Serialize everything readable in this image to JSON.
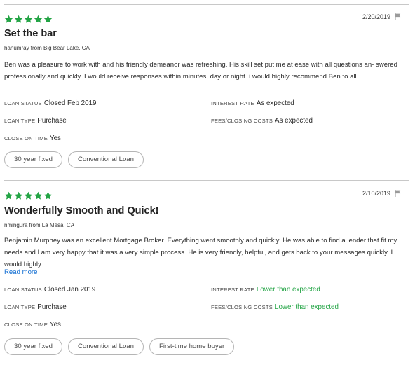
{
  "colors": {
    "star": "#23a445",
    "link": "#0b6ad1",
    "positive": "#23a445"
  },
  "icons": {
    "rating_star": "star-icon",
    "report": "flag-icon"
  },
  "reviews": [
    {
      "rating": 5,
      "date": "2/20/2019",
      "title": "Set the bar",
      "author": "hanumray from Big Bear Lake, CA",
      "body": "Ben was a pleasure to work with and his friendly demeanor was refreshing. His skill set put me at ease with all questions an- swered professionally and quickly. I would receive responses within minutes, day or night. i would highly recommend Ben to all.",
      "read_more": "",
      "loan_status_label": "LOAN STATUS",
      "loan_status": "Closed Feb 2019",
      "interest_rate_label": "INTEREST RATE",
      "interest_rate": "As expected",
      "loan_type_label": "LOAN TYPE",
      "loan_type": "Purchase",
      "fees_label": "FEES/CLOSING COSTS",
      "fees": "As expected",
      "close_on_time_label": "CLOSE ON TIME",
      "close_on_time": "Yes",
      "tags": [
        "30 year fixed",
        "Conventional Loan"
      ]
    },
    {
      "rating": 5,
      "date": "2/10/2019",
      "title": "Wonderfully Smooth and Quick!",
      "author": "nmingura from La Mesa, CA",
      "body": "Benjamin Murphey was an excellent Mortgage Broker. Everything went smoothly and quickly. He was able to find a lender that fit my needs and I am very happy that it was a very simple process. He is very friendly, helpful, and gets back to your messages quickly. I would highly ...",
      "read_more": "Read more",
      "loan_status_label": "LOAN STATUS",
      "loan_status": "Closed Jan 2019",
      "interest_rate_label": "INTEREST RATE",
      "interest_rate": "Lower than expected",
      "loan_type_label": "LOAN TYPE",
      "loan_type": "Purchase",
      "fees_label": "FEES/CLOSING COSTS",
      "fees": "Lower than expected",
      "close_on_time_label": "CLOSE ON TIME",
      "close_on_time": "Yes",
      "tags": [
        "30 year fixed",
        "Conventional Loan",
        "First-time home buyer"
      ]
    }
  ]
}
